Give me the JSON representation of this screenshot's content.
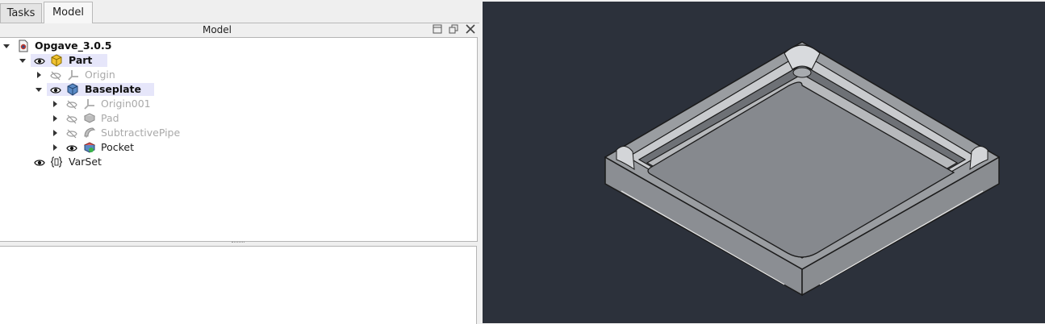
{
  "tabs": [
    {
      "label": "Tasks",
      "active": false
    },
    {
      "label": "Model",
      "active": true
    }
  ],
  "dock": {
    "title": "Model"
  },
  "tree": {
    "items": [
      {
        "label": "Opgave_3.0.5",
        "icon": "document-icon",
        "expanded": true,
        "visible": null,
        "bold": true,
        "dimmed": false
      },
      {
        "label": "Part",
        "icon": "part-icon",
        "expanded": true,
        "visible": true,
        "bold": true,
        "dimmed": false,
        "highlighted": true
      },
      {
        "label": "Origin",
        "icon": "origin-icon",
        "expanded": false,
        "visible": false,
        "bold": false,
        "dimmed": true
      },
      {
        "label": "Baseplate",
        "icon": "body-icon",
        "expanded": true,
        "visible": true,
        "bold": true,
        "dimmed": false,
        "highlighted": true
      },
      {
        "label": "Origin001",
        "icon": "origin-icon",
        "expanded": false,
        "visible": false,
        "bold": false,
        "dimmed": true
      },
      {
        "label": "Pad",
        "icon": "pad-icon",
        "expanded": false,
        "visible": false,
        "bold": false,
        "dimmed": true
      },
      {
        "label": "SubtractivePipe",
        "icon": "subtractive-pipe-icon",
        "expanded": false,
        "visible": false,
        "bold": false,
        "dimmed": true
      },
      {
        "label": "Pocket",
        "icon": "pocket-icon",
        "expanded": false,
        "visible": true,
        "bold": false,
        "dimmed": false
      },
      {
        "label": "VarSet",
        "icon": "varset-icon",
        "expanded": null,
        "visible": true,
        "bold": false,
        "dimmed": false
      }
    ]
  },
  "colors": {
    "viewport_background": "#2c313b",
    "model_face": "#8a8d91",
    "highlight_row": "#e6e6fa"
  }
}
